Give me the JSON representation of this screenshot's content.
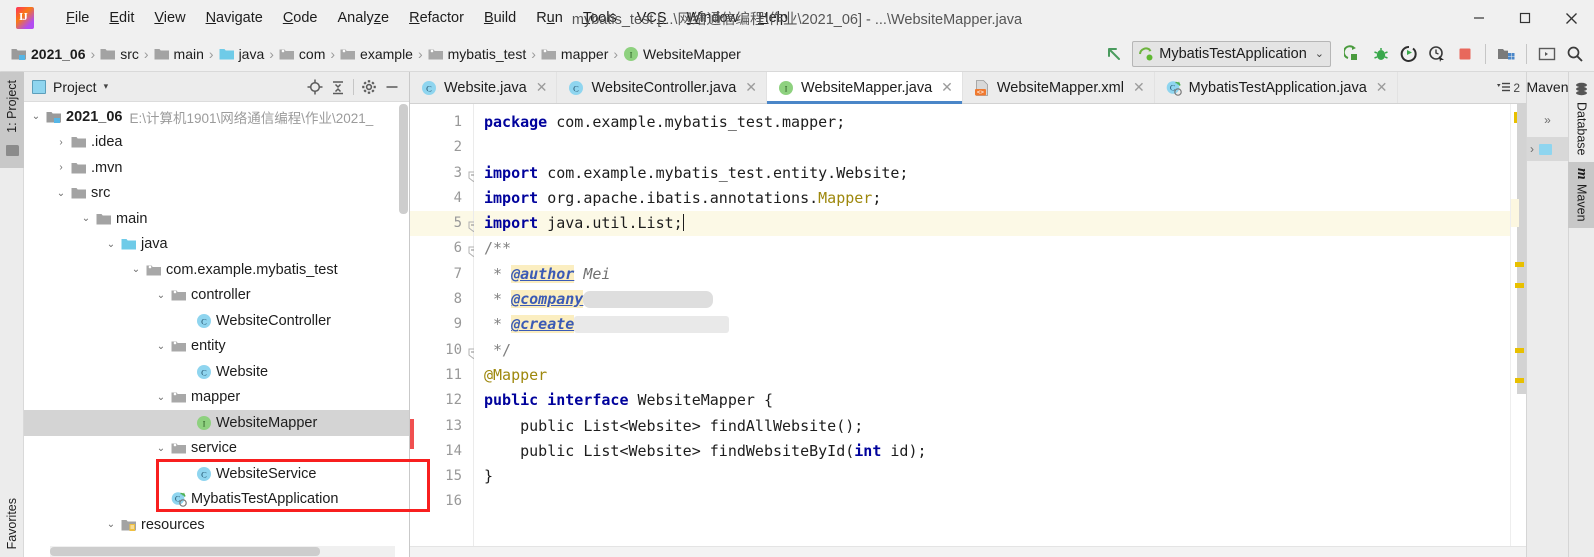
{
  "window": {
    "title": "mybatis_test [...\\网络通信编程\\作业\\2021_06] - ...\\WebsiteMapper.java",
    "minimize_label": "—",
    "maximize_label": "□",
    "close_label": "✕"
  },
  "menubar": {
    "items": [
      {
        "pre": "",
        "mn": "F",
        "post": "ile"
      },
      {
        "pre": "",
        "mn": "E",
        "post": "dit"
      },
      {
        "pre": "",
        "mn": "V",
        "post": "iew"
      },
      {
        "pre": "",
        "mn": "N",
        "post": "avigate"
      },
      {
        "pre": "",
        "mn": "C",
        "post": "ode"
      },
      {
        "pre": "Analy",
        "mn": "z",
        "post": "e"
      },
      {
        "pre": "",
        "mn": "R",
        "post": "efactor"
      },
      {
        "pre": "",
        "mn": "B",
        "post": "uild"
      },
      {
        "pre": "R",
        "mn": "u",
        "post": "n"
      },
      {
        "pre": "",
        "mn": "T",
        "post": "ools"
      },
      {
        "pre": "VC",
        "mn": "S",
        "post": ""
      },
      {
        "pre": "",
        "mn": "W",
        "post": "indow"
      },
      {
        "pre": "",
        "mn": "H",
        "post": "elp"
      }
    ]
  },
  "breadcrumb": {
    "items": [
      {
        "label": "2021_06",
        "icon": "module-folder-icon",
        "kind": "module"
      },
      {
        "label": "src",
        "icon": "folder-icon",
        "kind": "folder"
      },
      {
        "label": "main",
        "icon": "folder-icon",
        "kind": "folder"
      },
      {
        "label": "java",
        "icon": "source-folder-icon",
        "kind": "source"
      },
      {
        "label": "com",
        "icon": "package-icon",
        "kind": "package"
      },
      {
        "label": "example",
        "icon": "package-icon",
        "kind": "package"
      },
      {
        "label": "mybatis_test",
        "icon": "package-icon",
        "kind": "package"
      },
      {
        "label": "mapper",
        "icon": "package-icon",
        "kind": "package"
      },
      {
        "label": "WebsiteMapper",
        "icon": "interface-icon",
        "kind": "interface"
      }
    ],
    "separator": "›"
  },
  "toolbar": {
    "back_icon": "back-arrow-icon",
    "run_config": "MybatisTestApplication",
    "run_config_chevron": "⌄",
    "buttons": [
      {
        "name": "run-button",
        "icon": "run-icon"
      },
      {
        "name": "debug-button",
        "icon": "debug-bug-icon"
      },
      {
        "name": "run-with-coverage-button",
        "icon": "run-coverage-icon"
      },
      {
        "name": "profile-button",
        "icon": "profiler-icon"
      },
      {
        "name": "stop-button",
        "icon": "stop-square-icon"
      },
      {
        "name": "project-structure-button",
        "icon": "project-structure-icon"
      },
      {
        "name": "terminal-button",
        "icon": "terminal-icon"
      },
      {
        "name": "search-everywhere-button",
        "icon": "search-icon"
      }
    ]
  },
  "left_strip": {
    "project_tab": "1: Project",
    "favorites_tab": "Favorites"
  },
  "project_panel": {
    "title": "Project",
    "chevron": "▾",
    "tools": [
      {
        "name": "scroll-from-source-button",
        "icon": "target-icon"
      },
      {
        "name": "collapse-all-button",
        "icon": "collapse-all-icon"
      },
      {
        "name": "settings-button",
        "icon": "gear-icon"
      },
      {
        "name": "hide-button",
        "icon": "minimize-icon"
      }
    ],
    "tree": [
      {
        "label": "2021_06",
        "path": "E:\\计算机1901\\网络通信编程\\作业\\2021_",
        "depth": 0,
        "arrow": "⌄",
        "icon": "module-folder-icon",
        "bold": true,
        "selected": false
      },
      {
        "label": ".idea",
        "path": "",
        "depth": 1,
        "arrow": "›",
        "icon": "folder-icon",
        "bold": false,
        "selected": false
      },
      {
        "label": ".mvn",
        "path": "",
        "depth": 1,
        "arrow": "›",
        "icon": "folder-icon",
        "bold": false,
        "selected": false
      },
      {
        "label": "src",
        "path": "",
        "depth": 1,
        "arrow": "⌄",
        "icon": "folder-icon",
        "bold": false,
        "selected": false
      },
      {
        "label": "main",
        "path": "",
        "depth": 2,
        "arrow": "⌄",
        "icon": "folder-icon",
        "bold": false,
        "selected": false
      },
      {
        "label": "java",
        "path": "",
        "depth": 3,
        "arrow": "⌄",
        "icon": "source-folder-icon",
        "bold": false,
        "selected": false
      },
      {
        "label": "com.example.mybatis_test",
        "path": "",
        "depth": 4,
        "arrow": "⌄",
        "icon": "package-icon",
        "bold": false,
        "selected": false
      },
      {
        "label": "controller",
        "path": "",
        "depth": 5,
        "arrow": "⌄",
        "icon": "package-icon",
        "bold": false,
        "selected": false
      },
      {
        "label": "WebsiteController",
        "path": "",
        "depth": 6,
        "arrow": "",
        "icon": "class-icon",
        "bold": false,
        "selected": false
      },
      {
        "label": "entity",
        "path": "",
        "depth": 5,
        "arrow": "⌄",
        "icon": "package-icon",
        "bold": false,
        "selected": false
      },
      {
        "label": "Website",
        "path": "",
        "depth": 6,
        "arrow": "",
        "icon": "class-icon",
        "bold": false,
        "selected": false
      },
      {
        "label": "mapper",
        "path": "",
        "depth": 5,
        "arrow": "⌄",
        "icon": "package-icon",
        "bold": false,
        "selected": false
      },
      {
        "label": "WebsiteMapper",
        "path": "",
        "depth": 6,
        "arrow": "",
        "icon": "interface-icon",
        "bold": false,
        "selected": true
      },
      {
        "label": "service",
        "path": "",
        "depth": 5,
        "arrow": "⌄",
        "icon": "package-icon",
        "bold": false,
        "selected": false
      },
      {
        "label": "WebsiteService",
        "path": "",
        "depth": 6,
        "arrow": "",
        "icon": "class-icon",
        "bold": false,
        "selected": false
      },
      {
        "label": "MybatisTestApplication",
        "path": "",
        "depth": 5,
        "arrow": "",
        "icon": "runnable-class-icon",
        "bold": false,
        "selected": false
      },
      {
        "label": "resources",
        "path": "",
        "depth": 3,
        "arrow": "⌄",
        "icon": "resources-folder-icon",
        "bold": false,
        "selected": false
      }
    ],
    "annotation": {
      "color": "#f81f1f",
      "target": "mapper-and-websitemapper-rows"
    }
  },
  "editor": {
    "tabs": [
      {
        "label": "Website.java",
        "icon": "class-icon",
        "active": false,
        "close": "✕"
      },
      {
        "label": "WebsiteController.java",
        "icon": "class-icon",
        "active": false,
        "close": "✕"
      },
      {
        "label": "WebsiteMapper.java",
        "icon": "interface-icon",
        "active": true,
        "close": "✕"
      },
      {
        "label": "WebsiteMapper.xml",
        "icon": "xml-file-icon",
        "active": false,
        "close": "✕"
      },
      {
        "label": "MybatisTestApplication.java",
        "icon": "runnable-class-icon",
        "active": false,
        "close": "✕"
      }
    ],
    "tab_overflow_count": "2",
    "tab_overflow_icon": "tab-list-icon",
    "line_numbers": [
      "1",
      "2",
      "3",
      "4",
      "5",
      "6",
      "7",
      "8",
      "9",
      "10",
      "11",
      "12",
      "13",
      "14",
      "15",
      "16"
    ],
    "current_line": 5,
    "code_lines": [
      {
        "n": 1,
        "segments": [
          {
            "t": "package",
            "c": "kw"
          },
          {
            "t": " com.example.mybatis_test.mapper;",
            "c": ""
          }
        ]
      },
      {
        "n": 2,
        "segments": []
      },
      {
        "n": 3,
        "segments": [
          {
            "t": "import",
            "c": "kw"
          },
          {
            "t": " com.example.mybatis_test.entity.Website;",
            "c": ""
          }
        ],
        "fold": "⊖"
      },
      {
        "n": 4,
        "segments": [
          {
            "t": "import",
            "c": "kw"
          },
          {
            "t": " org.apache.ibatis.annotations.",
            "c": ""
          },
          {
            "t": "Mapper",
            "c": "ann"
          },
          {
            "t": ";",
            "c": ""
          }
        ]
      },
      {
        "n": 5,
        "segments": [
          {
            "t": "import",
            "c": "kw"
          },
          {
            "t": " java.util.List;",
            "c": ""
          },
          {
            "t": "",
            "c": "caret"
          }
        ],
        "fold": "⊖"
      },
      {
        "n": 6,
        "segments": [
          {
            "t": "/**",
            "c": "cmt"
          }
        ],
        "fold": "⊖"
      },
      {
        "n": 7,
        "segments": [
          {
            "t": " * ",
            "c": "cmt"
          },
          {
            "t": "@author",
            "c": "cmt-tag"
          },
          {
            "t": " Mei",
            "c": "cmt-val"
          }
        ]
      },
      {
        "n": 8,
        "segments": [
          {
            "t": " * ",
            "c": "cmt"
          },
          {
            "t": "@company",
            "c": "cmt-tag"
          },
          {
            "t": "redacted-1",
            "c": "redact"
          }
        ]
      },
      {
        "n": 9,
        "segments": [
          {
            "t": " * ",
            "c": "cmt"
          },
          {
            "t": "@create",
            "c": "cmt-tag"
          },
          {
            "t": "redacted-2",
            "c": "redact2"
          }
        ]
      },
      {
        "n": 10,
        "segments": [
          {
            "t": " */",
            "c": "cmt"
          }
        ],
        "fold": "⊖"
      },
      {
        "n": 11,
        "segments": [
          {
            "t": "@Mapper",
            "c": "ann"
          }
        ]
      },
      {
        "n": 12,
        "segments": [
          {
            "t": "public interface",
            "c": "kw"
          },
          {
            "t": " WebsiteMapper {",
            "c": ""
          }
        ]
      },
      {
        "n": 13,
        "segments": [
          {
            "t": "    public List<Website> findAllWebsite();",
            "c": ""
          }
        ]
      },
      {
        "n": 14,
        "segments": [
          {
            "t": "    public List<Website> findWebsiteById(",
            "c": ""
          },
          {
            "t": "int",
            "c": "kw"
          },
          {
            "t": " id);",
            "c": ""
          }
        ]
      },
      {
        "n": 15,
        "segments": [
          {
            "t": "}",
            "c": ""
          }
        ]
      },
      {
        "n": 16,
        "segments": []
      }
    ],
    "stripe_marks": [
      "warning",
      "warning",
      "warning",
      "warning"
    ],
    "stripe_color": "#e8c000"
  },
  "right_panel": {
    "maven_label": "Maven",
    "expand_icon": "»",
    "maven_row_arrow": "›",
    "tabs": [
      {
        "label": "Database",
        "icon": "database-icon",
        "active": false
      },
      {
        "label": "Maven",
        "icon": "maven-m-icon",
        "active": true
      }
    ]
  }
}
